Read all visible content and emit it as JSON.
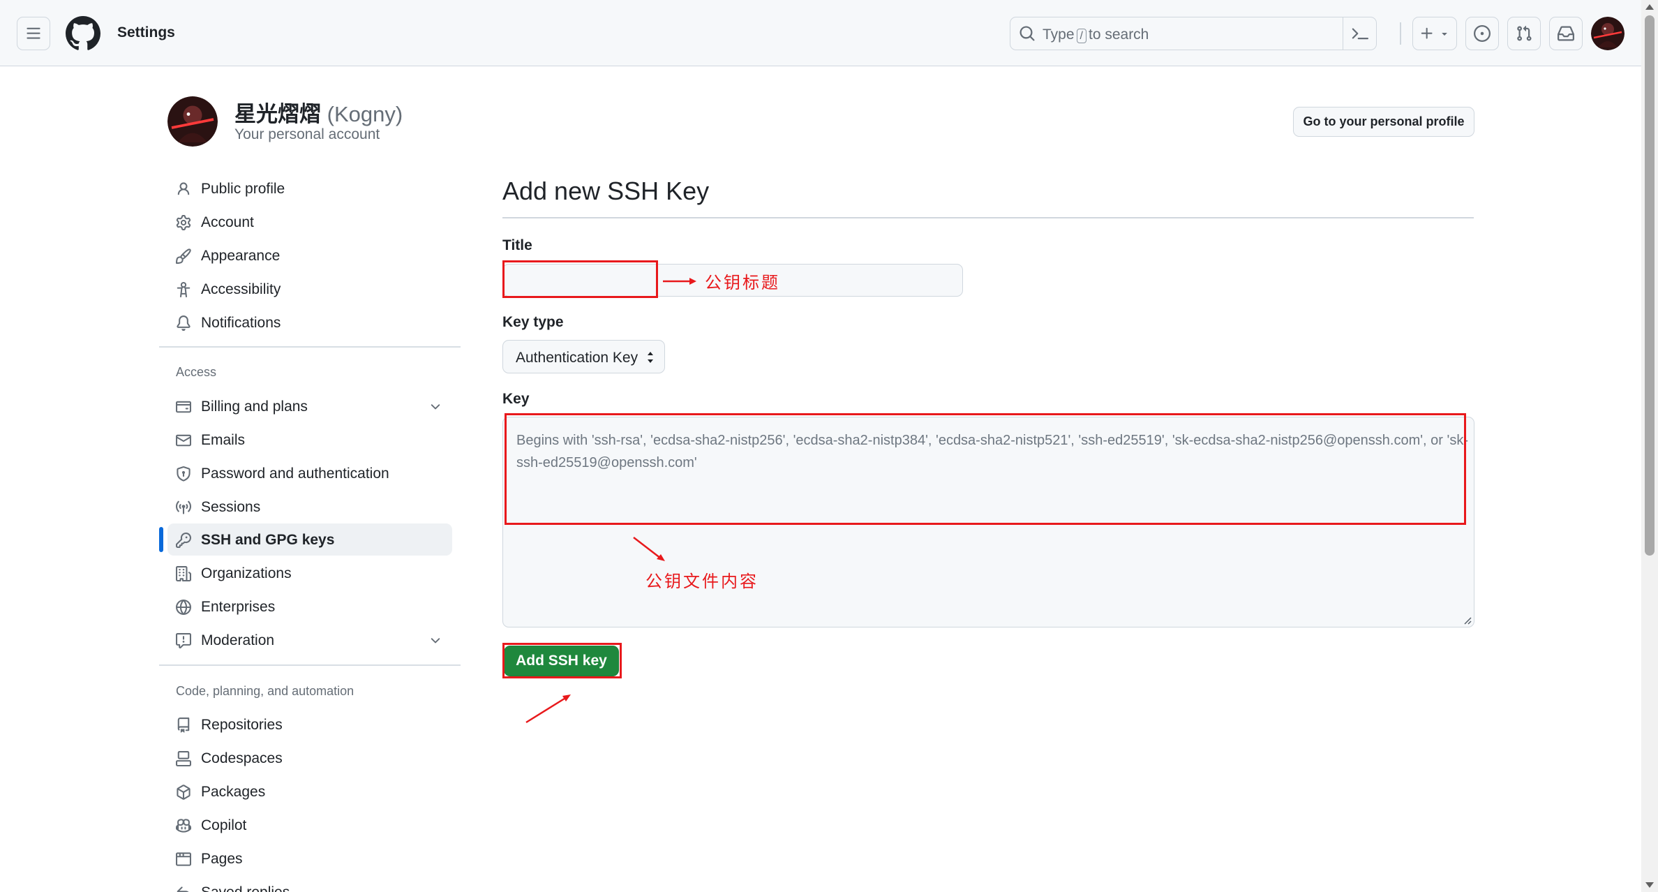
{
  "header": {
    "context_title": "Settings",
    "search_prefix": "Type",
    "search_key": "/",
    "search_suffix": "to search",
    "icons": [
      "hamburger-icon",
      "github-logo",
      "search-icon",
      "terminal-icon",
      "plus-icon",
      "issues-icon",
      "pull-request-icon",
      "inbox-icon"
    ]
  },
  "profile": {
    "name": "星光熠熠",
    "login": "(Kogny)",
    "subtitle": "Your personal account",
    "profile_button": "Go to your personal profile"
  },
  "sidebar": {
    "top_items": [
      {
        "label": "Public profile",
        "icon": "person-icon"
      },
      {
        "label": "Account",
        "icon": "gear-icon"
      },
      {
        "label": "Appearance",
        "icon": "paintbrush-icon"
      },
      {
        "label": "Accessibility",
        "icon": "accessibility-icon"
      },
      {
        "label": "Notifications",
        "icon": "bell-icon"
      }
    ],
    "access_heading": "Access",
    "access_items": [
      {
        "label": "Billing and plans",
        "icon": "credit-card-icon",
        "expandable": true
      },
      {
        "label": "Emails",
        "icon": "mail-icon"
      },
      {
        "label": "Password and authentication",
        "icon": "shield-lock-icon"
      },
      {
        "label": "Sessions",
        "icon": "broadcast-icon"
      },
      {
        "label": "SSH and GPG keys",
        "icon": "key-icon",
        "active": true
      },
      {
        "label": "Organizations",
        "icon": "organization-icon"
      },
      {
        "label": "Enterprises",
        "icon": "globe-icon"
      },
      {
        "label": "Moderation",
        "icon": "report-icon",
        "expandable": true
      }
    ],
    "code_heading": "Code, planning, and automation",
    "code_items": [
      {
        "label": "Repositories",
        "icon": "repo-icon"
      },
      {
        "label": "Codespaces",
        "icon": "codespaces-icon"
      },
      {
        "label": "Packages",
        "icon": "package-icon"
      },
      {
        "label": "Copilot",
        "icon": "copilot-icon"
      },
      {
        "label": "Pages",
        "icon": "browser-icon"
      },
      {
        "label": "Saved replies",
        "icon": "reply-icon"
      }
    ]
  },
  "main": {
    "page_title": "Add new SSH Key",
    "title_label": "Title",
    "title_value": "",
    "key_type_label": "Key type",
    "key_type_value": "Authentication Key",
    "key_label": "Key",
    "key_placeholder": "Begins with 'ssh-rsa', 'ecdsa-sha2-nistp256', 'ecdsa-sha2-nistp384', 'ecdsa-sha2-nistp521', 'ssh-ed25519', 'sk-ecdsa-sha2-nistp256@openssh.com', or 'sk-ssh-ed25519@openssh.com'",
    "key_value": "",
    "submit_label": "Add SSH key"
  },
  "annotations": {
    "title_note": "公钥标题",
    "key_note": "公钥文件内容",
    "color": "#e8191c"
  },
  "colors": {
    "accent_blue": "#0969da",
    "primary_green": "#1f883d",
    "header_bg": "#f6f8fa"
  }
}
